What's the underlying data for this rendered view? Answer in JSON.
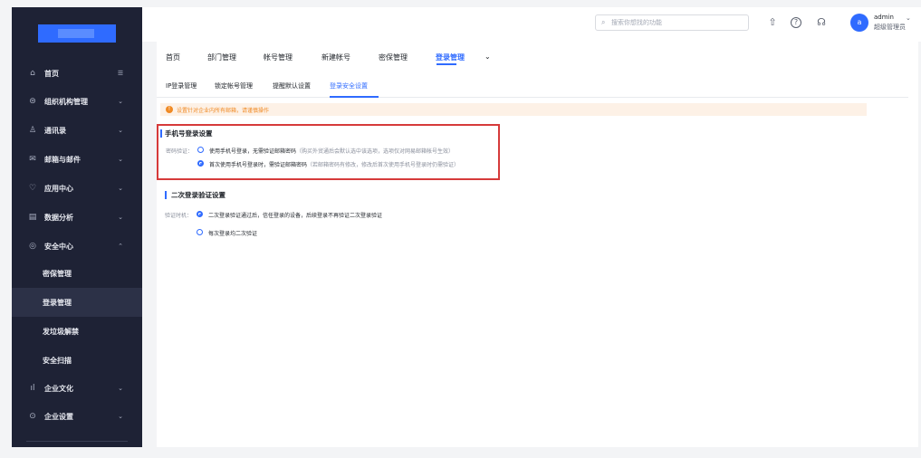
{
  "sidebar": {
    "items": [
      {
        "icon": "home-icon",
        "glyph": "⌂",
        "label": "首页",
        "chev": "☰"
      },
      {
        "icon": "org-icon",
        "glyph": "⊜",
        "label": "组织机构管理",
        "chev": "⌄"
      },
      {
        "icon": "contacts-icon",
        "glyph": "♙",
        "label": "通讯录",
        "chev": "⌄"
      },
      {
        "icon": "mail-icon",
        "glyph": "✉",
        "label": "邮箱与邮件",
        "chev": "⌄"
      },
      {
        "icon": "apps-icon",
        "glyph": "♡",
        "label": "应用中心",
        "chev": "⌄"
      },
      {
        "icon": "analytics-icon",
        "glyph": "▤",
        "label": "数据分析",
        "chev": "⌄"
      },
      {
        "icon": "security-icon",
        "glyph": "◎",
        "label": "安全中心",
        "chev": "⌃"
      }
    ],
    "security_sub": [
      "密保管理",
      "登录管理",
      "发垃圾解禁",
      "安全扫描"
    ],
    "bottom_items": [
      {
        "icon": "culture-icon",
        "glyph": "ıl",
        "label": "企业文化",
        "chev": "⌄"
      },
      {
        "icon": "settings-icon",
        "glyph": "⊙",
        "label": "企业设置",
        "chev": "⌄"
      }
    ]
  },
  "header": {
    "search_placeholder": "搜索你想找的功能",
    "search_glyph": "⌕",
    "upload_glyph": "⇧",
    "help_glyph": "?",
    "support_glyph": "☊",
    "avatar_letter": "a",
    "user_name": "admin",
    "user_role": "超级管理员",
    "user_chev": "⌄"
  },
  "tabs": [
    "首页",
    "部门管理",
    "帐号管理",
    "新建帐号",
    "密保管理",
    "登录管理"
  ],
  "tab_more": "⌄",
  "subtabs": [
    "IP登录管理",
    "锁定帐号管理",
    "提醒默认设置",
    "登录安全设置"
  ],
  "notice": {
    "glyph": "!",
    "text": "设置针对企业内所有邮箱，请谨慎操作"
  },
  "phone_section": {
    "title": "手机号登录设置",
    "field_label": "密码验证：",
    "option1": "使用手机号登录，无需验证邮箱密码",
    "option1_hint": "（购买外贸通后会默认选中该选项，选项仅对网易邮箱帐号生效）",
    "option2": "首次使用手机号登录时，需验证邮箱密码",
    "option2_hint": "（若邮箱密码有修改，修改后首次使用手机号登录时仍需验证）"
  },
  "twofa_section": {
    "title": "二次登录验证设置",
    "field_label": "验证时机：",
    "option1": "二次登录验证通过后，信任登录的设备，后续登录不再验证二次登录验证",
    "option2": "每次登录均二次验证"
  }
}
